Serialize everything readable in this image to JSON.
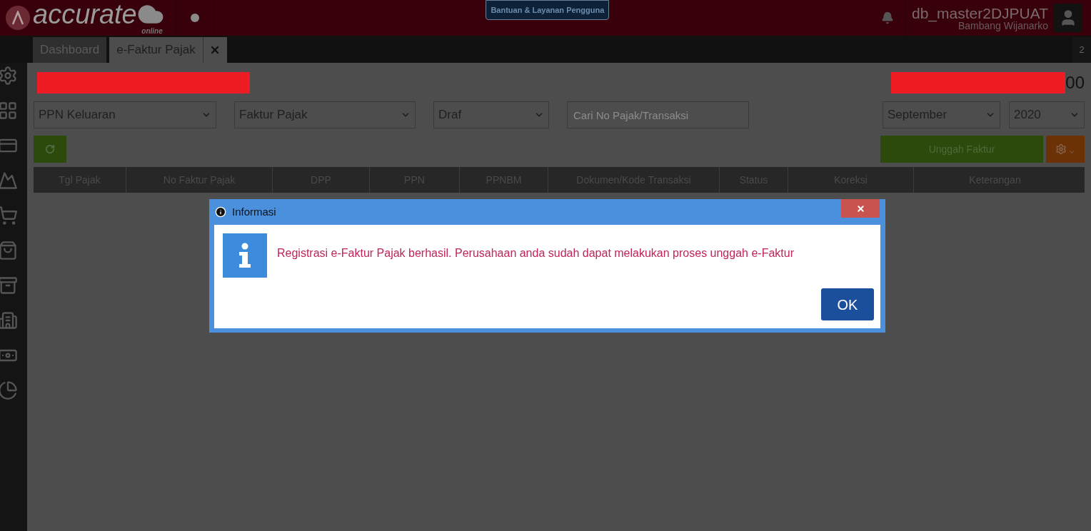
{
  "header": {
    "logo": "accurate",
    "logo_sub": "online",
    "help_button": "Bantuan & Layanan Pengguna",
    "database": "db_master2DJPUAT",
    "user": "Bambang Wijanarko"
  },
  "tabs": [
    {
      "label": "Dashboard",
      "selected": false
    },
    {
      "label": "e-Faktur Pajak",
      "selected": true
    }
  ],
  "tab_count": "2",
  "page": {
    "title_tail": "00"
  },
  "filters": [
    {
      "kind": "select",
      "value": "PPN Keluaran"
    },
    {
      "kind": "select",
      "value": "Faktur Pajak"
    },
    {
      "kind": "select",
      "value": "Draf"
    },
    {
      "kind": "search",
      "placeholder": "Cari No Pajak/Transaksi"
    }
  ],
  "period": [
    {
      "kind": "select",
      "value": "September"
    },
    {
      "kind": "select",
      "value": "2020"
    }
  ],
  "upload_button": "Unggah Faktur",
  "table": {
    "columns": [
      "Tgl Pajak",
      "No Faktur Pajak",
      "DPP",
      "PPN",
      "PPNBM",
      "Dokumen/Kode Transaksi",
      "Status",
      "Koreksi",
      "Keterangan"
    ]
  },
  "dialog": {
    "title": "Informasi",
    "message": "Registrasi e-Faktur Pajak berhasil. Perusahaan anda sudah dapat melakukan proses unggah e-Faktur",
    "ok_button": "OK"
  }
}
